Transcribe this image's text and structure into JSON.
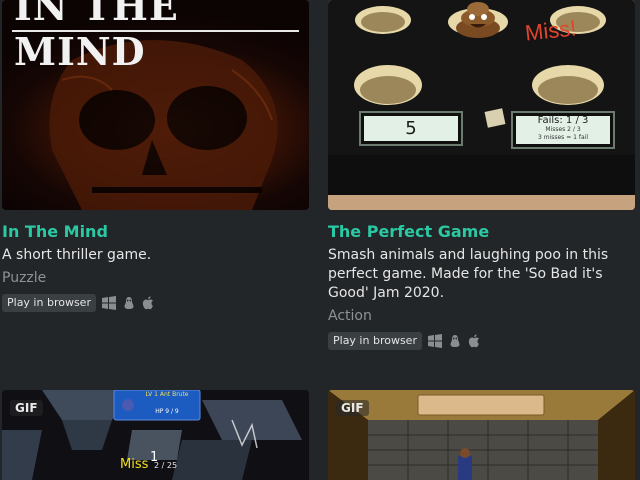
{
  "games": [
    {
      "title": "In The Mind",
      "description": "A short thriller game.",
      "genre": "Puzzle",
      "play_label": "Play in browser",
      "thumb_text": "IN THE MIND",
      "platforms": [
        "windows-icon",
        "linux-icon",
        "apple-icon"
      ]
    },
    {
      "title": "The Perfect Game",
      "description": "Smash animals and laughing poo in this perfect game. Made for the 'So Bad it's Good' Jam 2020.",
      "genre": "Action",
      "play_label": "Play in browser",
      "thumb": {
        "miss_text": "Miss!",
        "score_value": "5",
        "fails_text": "Fails: 1 / 3",
        "misses_text": "Misses 2 / 3",
        "rule_text": "3 misses = 1 fail"
      },
      "platforms": [
        "windows-icon",
        "linux-icon",
        "apple-icon"
      ]
    },
    {
      "gif_label": "GIF",
      "thumb": {
        "enemy_name": "LV 1 Ant Brute",
        "enemy_hp": "HP 9 / 9",
        "miss_text": "Miss",
        "damage_text": "1",
        "hp_small": "2 / 25"
      }
    },
    {
      "gif_label": "GIF"
    }
  ],
  "colors": {
    "background": "#222628",
    "title_accent": "#2bc8a4"
  }
}
